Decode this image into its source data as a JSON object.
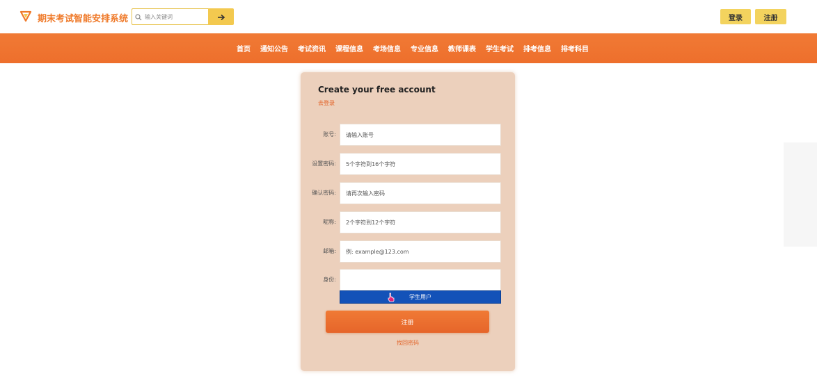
{
  "header": {
    "app_title": "期末考试智能安排系统",
    "search_placeholder": "输入关键词",
    "login_label": "登录",
    "register_label": "注册"
  },
  "nav": {
    "items": [
      "首页",
      "通知公告",
      "考试资讯",
      "课程信息",
      "考场信息",
      "专业信息",
      "教师课表",
      "学生考试",
      "排考信息",
      "排考科目"
    ]
  },
  "form": {
    "title": "Create your free account",
    "login_link": "去登录",
    "fields": [
      {
        "label": "账号:",
        "placeholder": "请输入账号"
      },
      {
        "label": "设置密码:",
        "placeholder": "5个字符到16个字符"
      },
      {
        "label": "确认密码:",
        "placeholder": "请再次输入密码"
      },
      {
        "label": "昵称:",
        "placeholder": "2个字符到12个字符"
      },
      {
        "label": "邮箱:",
        "placeholder": "例: example@123.com"
      },
      {
        "label": "身份:",
        "placeholder": ""
      }
    ],
    "identity_option": "学生用户",
    "submit_label": "注册",
    "forgot_link": "找回密码"
  },
  "colors": {
    "brand_orange": "#ef7a2a",
    "nav_bg": "#f07a35",
    "button_yellow": "#f3d35e",
    "card_bg": "#ecd0bc",
    "dropdown_blue": "#1352b8"
  }
}
